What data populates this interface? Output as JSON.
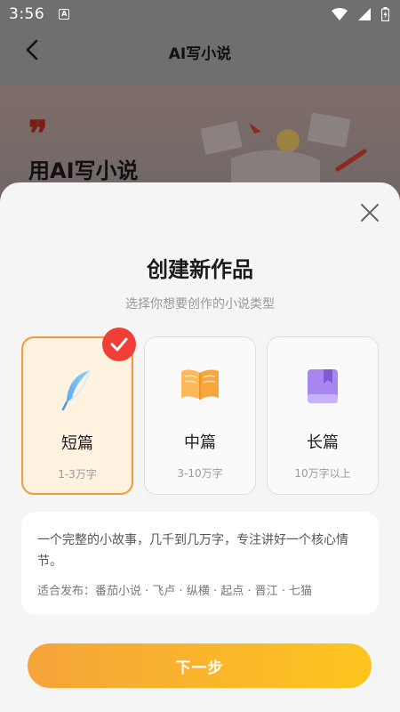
{
  "status_bar": {
    "time": "3:56",
    "app_badge": "A"
  },
  "header": {
    "title": "AI写小说"
  },
  "banner": {
    "quote_mark": "❞",
    "title": "用AI写小说"
  },
  "sheet": {
    "title": "创建新作品",
    "subtitle": "选择你想要创作的小说类型",
    "options": [
      {
        "name": "短篇",
        "range": "1-3万字",
        "icon": "feather-icon",
        "selected": true
      },
      {
        "name": "中篇",
        "range": "3-10万字",
        "icon": "open-book-icon",
        "selected": false
      },
      {
        "name": "长篇",
        "range": "10万字以上",
        "icon": "bookmarked-book-icon",
        "selected": false
      }
    ],
    "description": "一个完整的小故事，几千到几万字，专注讲好一个核心情节。",
    "platforms": "适合发布：番茄小说 · 飞卢 · 纵横 · 起点 · 晋江 · 七猫",
    "next_label": "下一步"
  },
  "colors": {
    "accent_border": "#f09a3a",
    "check_badge": "#ef3f36",
    "button_gradient_start": "#f5a43a",
    "button_gradient_end": "#fdc51e"
  }
}
